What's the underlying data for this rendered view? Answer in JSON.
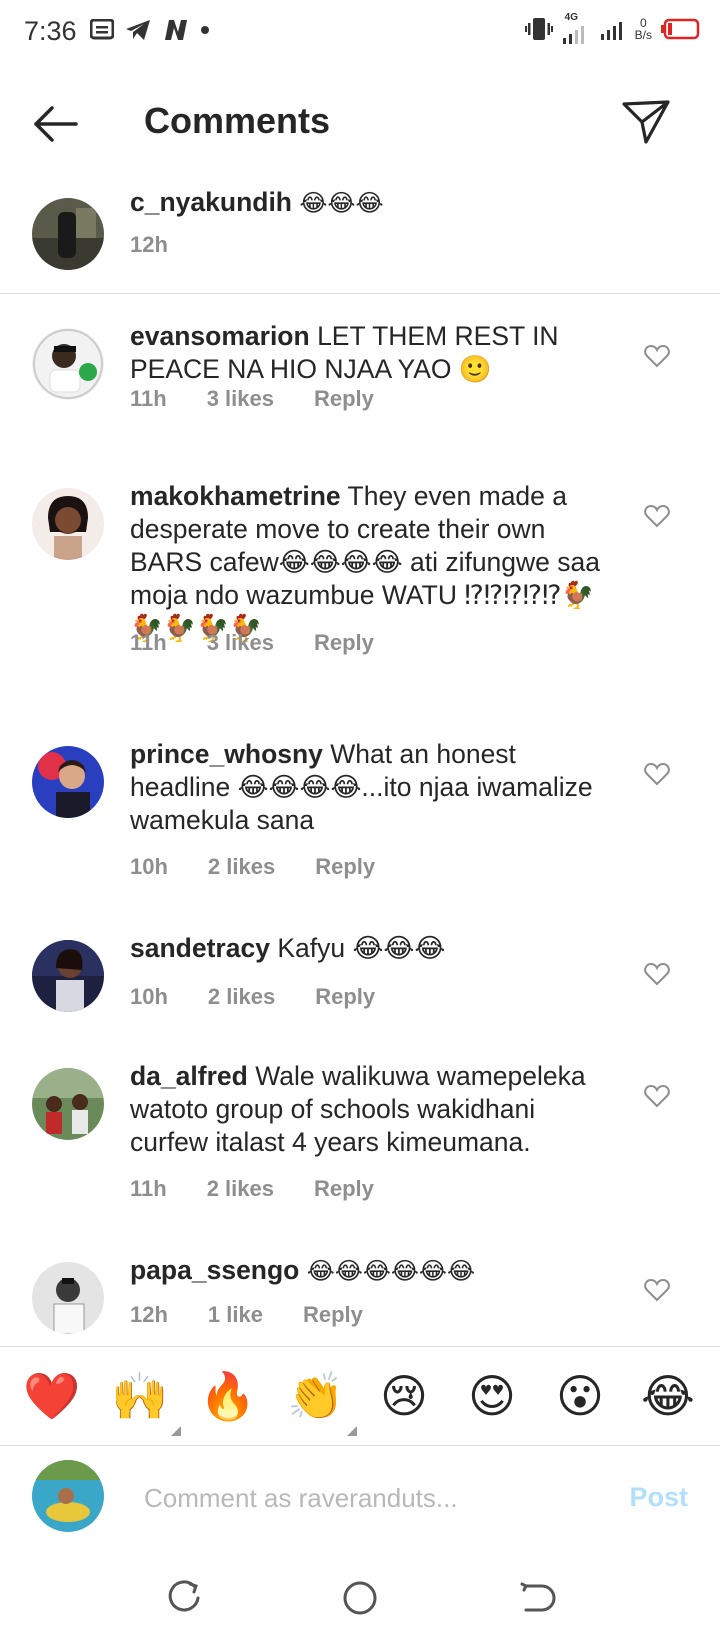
{
  "status_bar": {
    "time": "7:36",
    "network": "4G",
    "speed_value": "0",
    "speed_unit": "B/s"
  },
  "header": {
    "title": "Comments"
  },
  "caption": {
    "username": "c_nyakundih",
    "text": "😂😂😂",
    "time": "12h"
  },
  "comments": [
    {
      "username": "evansomarion",
      "text": "LET THEM REST IN PEACE NA HIO NJAA YAO 🙂",
      "time": "11h",
      "likes": "3 likes",
      "reply": "Reply"
    },
    {
      "username": "makokhametrine",
      "text": "They even made a desperate move to create their own BARS cafew😂😂😂😂 ati zifungwe saa moja ndo wazumbue WATU ⁉⁉⁉⁉⁉🐓🐓🐓🐓🐓",
      "time": "11h",
      "likes": "3 likes",
      "reply": "Reply"
    },
    {
      "username": "prince_whosny",
      "text": "What an honest headline 😂😂😂😂...ito njaa iwamalize wamekula sana",
      "time": "10h",
      "likes": "2 likes",
      "reply": "Reply"
    },
    {
      "username": "sandetracy",
      "text": "Kafyu 😂😂😂",
      "time": "10h",
      "likes": "2 likes",
      "reply": "Reply"
    },
    {
      "username": "da_alfred",
      "text": "Wale walikuwa wamepeleka watoto group of schools wakidhani curfew italast 4 years kimeumana.",
      "time": "11h",
      "likes": "2 likes",
      "reply": "Reply"
    },
    {
      "username": "papa_ssengo",
      "text": "😂😂😂😂😂😂",
      "time": "12h",
      "likes": "1 like",
      "reply": "Reply"
    }
  ],
  "reactions": [
    "❤️",
    "🙌",
    "🔥",
    "👏",
    "😢",
    "😍",
    "😮",
    "😂"
  ],
  "composer": {
    "placeholder": "Comment as raveranduts...",
    "post_label": "Post"
  },
  "colors": {
    "accent_disabled": "#b2dffc",
    "meta_gray": "#8e8e8e",
    "battery_red": "#e02424"
  }
}
